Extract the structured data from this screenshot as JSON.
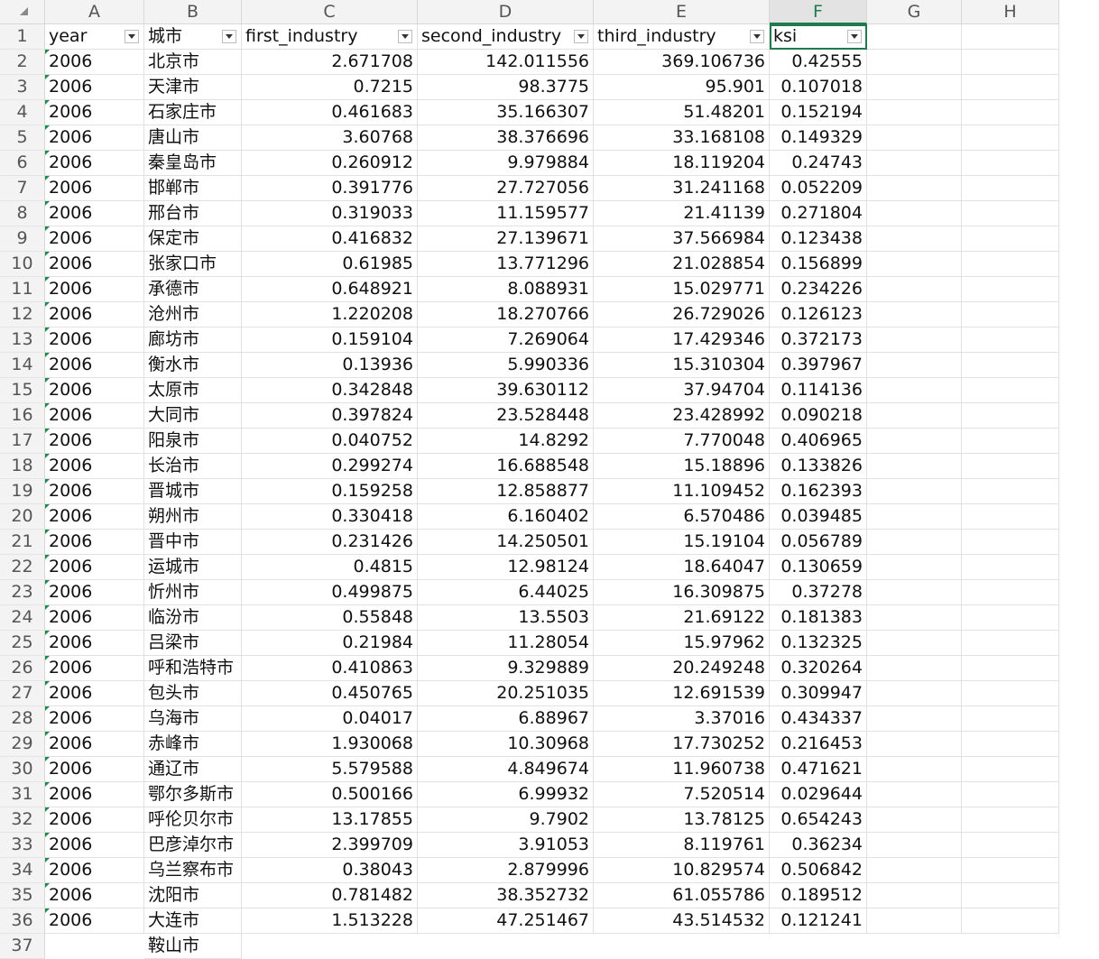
{
  "sheet": {
    "columns": [
      "A",
      "B",
      "C",
      "D",
      "E",
      "F",
      "G",
      "H"
    ],
    "selected_column": "F",
    "headers": [
      "year",
      "城市",
      "first_industry",
      "second_industry",
      "third_industry",
      "ksi"
    ],
    "rows": [
      [
        "2006",
        "北京市",
        "2.671708",
        "142.011556",
        "369.106736",
        "0.42555"
      ],
      [
        "2006",
        "天津市",
        "0.7215",
        "98.3775",
        "95.901",
        "0.107018"
      ],
      [
        "2006",
        "石家庄市",
        "0.461683",
        "35.166307",
        "51.48201",
        "0.152194"
      ],
      [
        "2006",
        "唐山市",
        "3.60768",
        "38.376696",
        "33.168108",
        "0.149329"
      ],
      [
        "2006",
        "秦皇岛市",
        "0.260912",
        "9.979884",
        "18.119204",
        "0.24743"
      ],
      [
        "2006",
        "邯郸市",
        "0.391776",
        "27.727056",
        "31.241168",
        "0.052209"
      ],
      [
        "2006",
        "邢台市",
        "0.319033",
        "11.159577",
        "21.41139",
        "0.271804"
      ],
      [
        "2006",
        "保定市",
        "0.416832",
        "27.139671",
        "37.566984",
        "0.123438"
      ],
      [
        "2006",
        "张家口市",
        "0.61985",
        "13.771296",
        "21.028854",
        "0.156899"
      ],
      [
        "2006",
        "承德市",
        "0.648921",
        "8.088931",
        "15.029771",
        "0.234226"
      ],
      [
        "2006",
        "沧州市",
        "1.220208",
        "18.270766",
        "26.729026",
        "0.126123"
      ],
      [
        "2006",
        "廊坊市",
        "0.159104",
        "7.269064",
        "17.429346",
        "0.372173"
      ],
      [
        "2006",
        "衡水市",
        "0.13936",
        "5.990336",
        "15.310304",
        "0.397967"
      ],
      [
        "2006",
        "太原市",
        "0.342848",
        "39.630112",
        "37.94704",
        "0.114136"
      ],
      [
        "2006",
        "大同市",
        "0.397824",
        "23.528448",
        "23.428992",
        "0.090218"
      ],
      [
        "2006",
        "阳泉市",
        "0.040752",
        "14.8292",
        "7.770048",
        "0.406965"
      ],
      [
        "2006",
        "长治市",
        "0.299274",
        "16.688548",
        "15.18896",
        "0.133826"
      ],
      [
        "2006",
        "晋城市",
        "0.159258",
        "12.858877",
        "11.109452",
        "0.162393"
      ],
      [
        "2006",
        "朔州市",
        "0.330418",
        "6.160402",
        "6.570486",
        "0.039485"
      ],
      [
        "2006",
        "晋中市",
        "0.231426",
        "14.250501",
        "15.19104",
        "0.056789"
      ],
      [
        "2006",
        "运城市",
        "0.4815",
        "12.98124",
        "18.64047",
        "0.130659"
      ],
      [
        "2006",
        "忻州市",
        "0.499875",
        "6.44025",
        "16.309875",
        "0.37278"
      ],
      [
        "2006",
        "临汾市",
        "0.55848",
        "13.5503",
        "21.69122",
        "0.181383"
      ],
      [
        "2006",
        "吕梁市",
        "0.21984",
        "11.28054",
        "15.97962",
        "0.132325"
      ],
      [
        "2006",
        "呼和浩特市",
        "0.410863",
        "9.329889",
        "20.249248",
        "0.320264"
      ],
      [
        "2006",
        "包头市",
        "0.450765",
        "20.251035",
        "12.691539",
        "0.309947"
      ],
      [
        "2006",
        "乌海市",
        "0.04017",
        "6.88967",
        "3.37016",
        "0.434337"
      ],
      [
        "2006",
        "赤峰市",
        "1.930068",
        "10.30968",
        "17.730252",
        "0.216453"
      ],
      [
        "2006",
        "通辽市",
        "5.579588",
        "4.849674",
        "11.960738",
        "0.471621"
      ],
      [
        "2006",
        "鄂尔多斯市",
        "0.500166",
        "6.99932",
        "7.520514",
        "0.029644"
      ],
      [
        "2006",
        "呼伦贝尔市",
        "13.17855",
        "9.7902",
        "13.78125",
        "0.654243"
      ],
      [
        "2006",
        "巴彦淖尔市",
        "2.399709",
        "3.91053",
        "8.119761",
        "0.36234"
      ],
      [
        "2006",
        "乌兰察布市",
        "0.38043",
        "2.879996",
        "10.829574",
        "0.506842"
      ],
      [
        "2006",
        "沈阳市",
        "0.781482",
        "38.352732",
        "61.055786",
        "0.189512"
      ],
      [
        "2006",
        "大连市",
        "1.513228",
        "47.251467",
        "43.514532",
        "0.121241"
      ]
    ],
    "partial_row_label": "37",
    "partial_row_text": "鞍山市"
  },
  "icons": {
    "corner": "select-all-icon",
    "filter": "filter-dropdown-icon"
  },
  "colors": {
    "accent": "#1f7a4d",
    "header_bg": "#f3f3f3",
    "gridline": "#e1e1e1"
  }
}
